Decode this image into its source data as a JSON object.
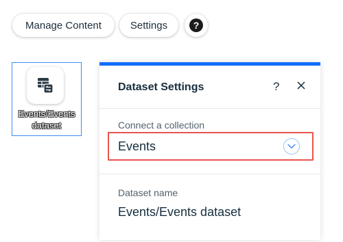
{
  "toolbar": {
    "manage_content_label": "Manage Content",
    "settings_label": "Settings",
    "help_label": "?"
  },
  "dataset_element": {
    "icon": "dataset-icon",
    "label_line1": "Events/Events",
    "label_line2": "dataset"
  },
  "panel": {
    "title": "Dataset Settings",
    "help_label": "?",
    "close_icon": "close-icon",
    "accent_color": "#116dff",
    "collection": {
      "label": "Connect a collection",
      "value": "Events",
      "highlight_color": "#e8544d"
    },
    "dataset_name": {
      "label": "Dataset name",
      "value": "Events/Events dataset"
    }
  }
}
